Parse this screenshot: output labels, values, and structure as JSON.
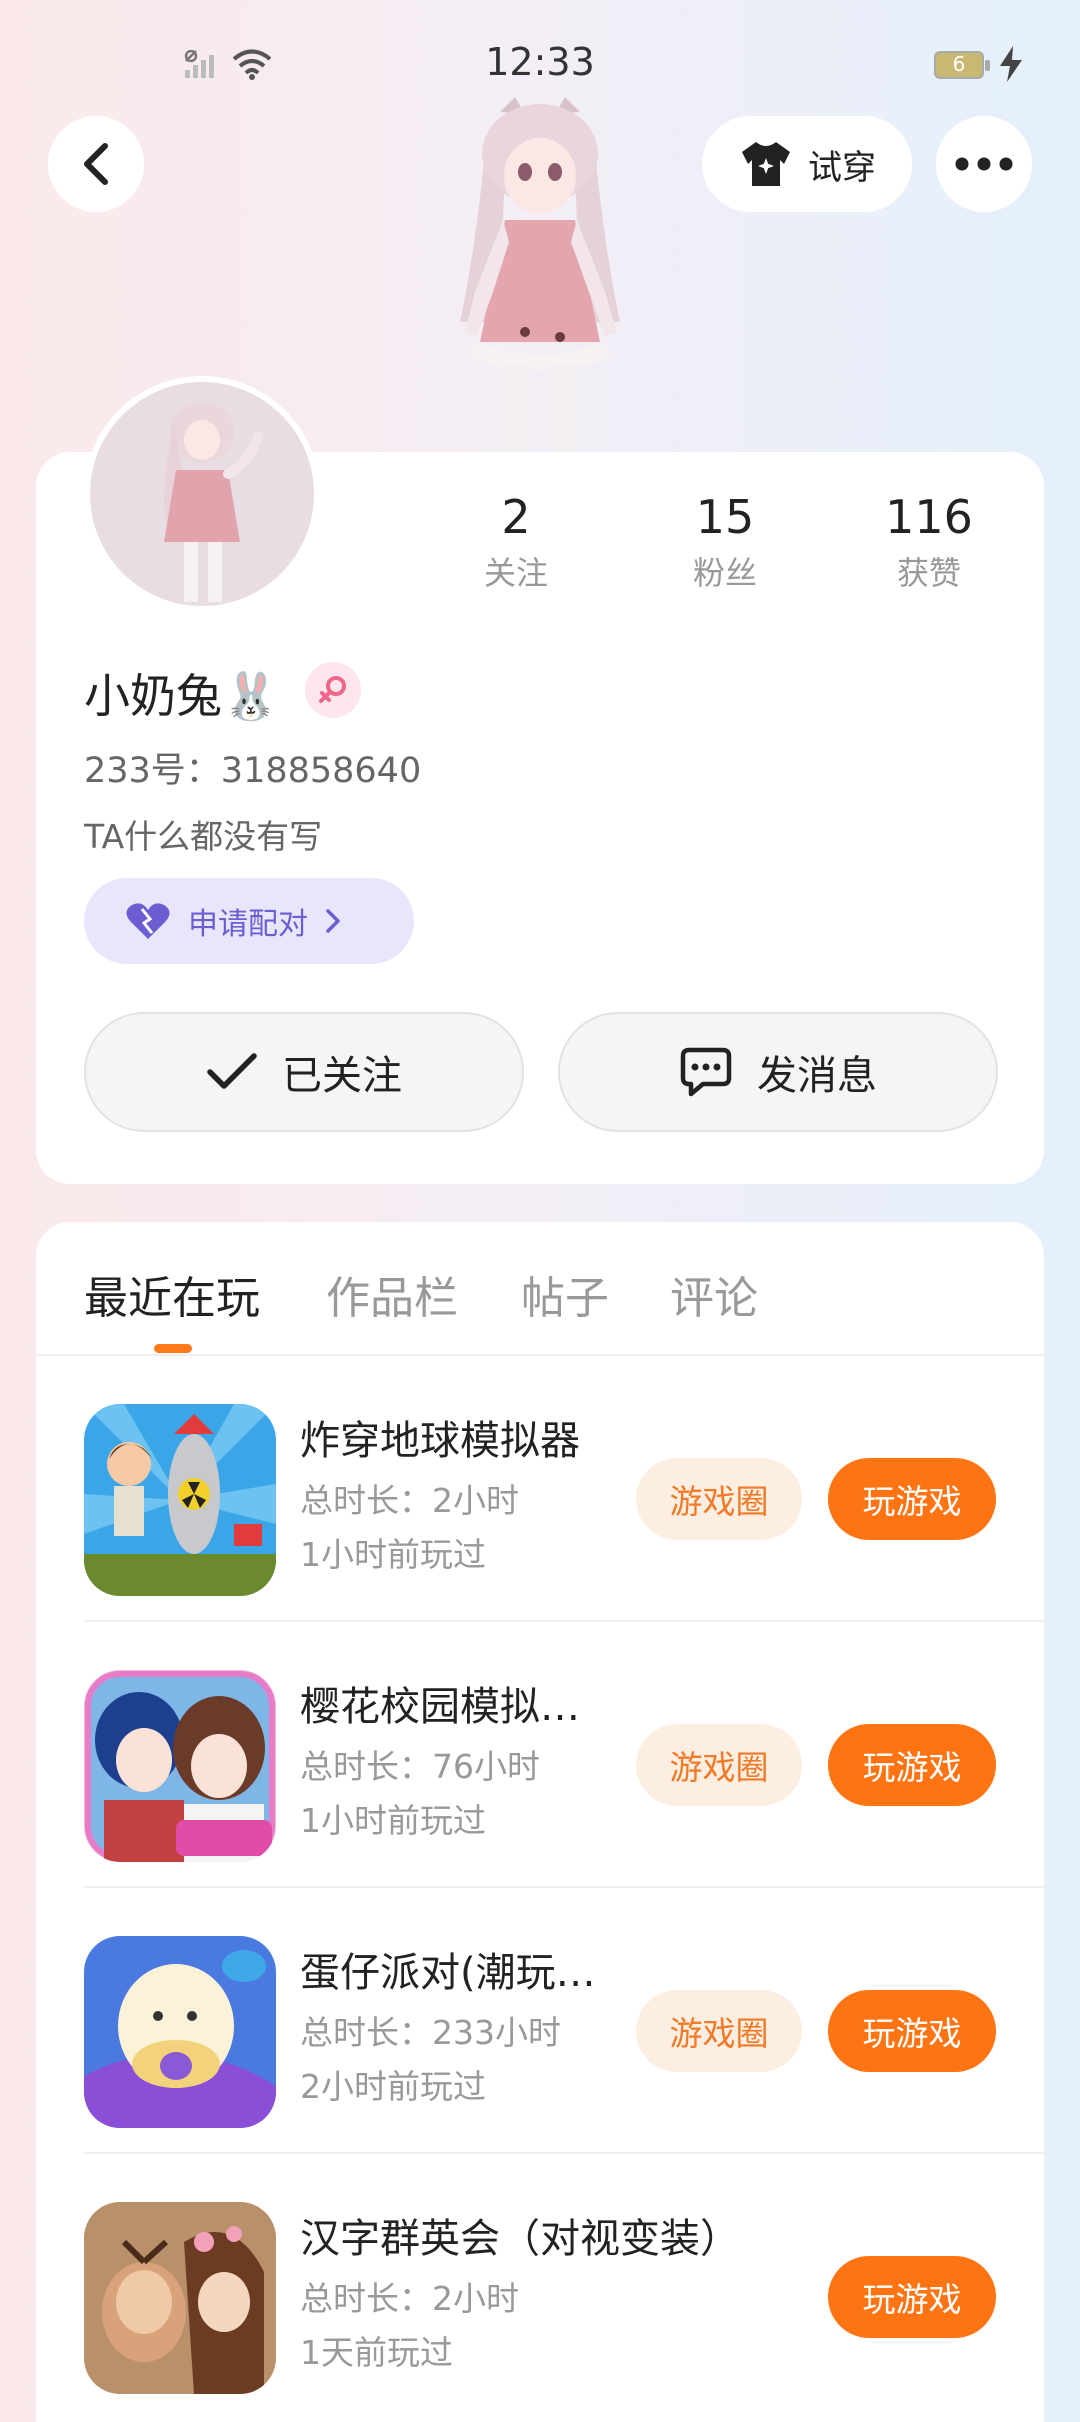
{
  "status_bar": {
    "time": "12:33",
    "battery": "6"
  },
  "header": {
    "tryon_label": "试穿"
  },
  "profile": {
    "stats": [
      {
        "value": "2",
        "label": "关注"
      },
      {
        "value": "15",
        "label": "粉丝"
      },
      {
        "value": "116",
        "label": "获赞"
      }
    ],
    "nickname": "小奶兔🐰",
    "id_text": "233号：318858640",
    "bio": "TA什么都没有写",
    "pair_label": "申请配对",
    "follow_label": "已关注",
    "message_label": "发消息"
  },
  "tabs": [
    "最近在玩",
    "作品栏",
    "帖子",
    "评论"
  ],
  "active_tab": 0,
  "games": [
    {
      "title": "炸穿地球模拟器",
      "duration": "总时长：2小时",
      "last_played": "1小时前玩过",
      "circle": "游戏圈",
      "play": "玩游戏"
    },
    {
      "title": "樱花校园模拟…",
      "duration": "总时长：76小时",
      "last_played": "1小时前玩过",
      "circle": "游戏圈",
      "play": "玩游戏"
    },
    {
      "title": "蛋仔派对(潮玩…",
      "duration": "总时长：233小时",
      "last_played": "2小时前玩过",
      "circle": "游戏圈",
      "play": "玩游戏"
    },
    {
      "title": "汉字群英会（对视变装）",
      "duration": "总时长：2小时",
      "last_played": "1天前玩过",
      "play": "玩游戏"
    }
  ],
  "colors": {
    "accent": "#ff7412",
    "accent_soft": "#fdeee2",
    "pair_bg": "#e7e6fb",
    "pair_text": "#6c5dd3"
  },
  "icons": [
    "signal-icon",
    "wifi-icon",
    "battery-icon",
    "charging-icon",
    "back-icon",
    "shirt-icon",
    "more-icon",
    "female-icon",
    "heart-icon",
    "chevron-right-icon",
    "check-icon",
    "chat-icon"
  ]
}
